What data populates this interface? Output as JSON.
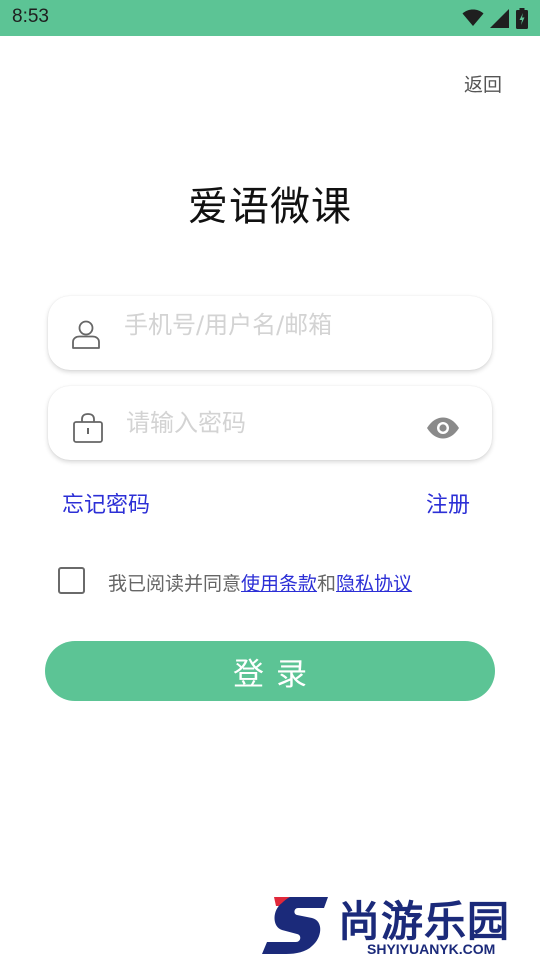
{
  "status_bar": {
    "time": "8:53",
    "background_color": "#5cc495",
    "icons": [
      "wifi-icon",
      "signal-icon",
      "battery-charging-icon"
    ]
  },
  "header": {
    "back_label": "返回"
  },
  "app": {
    "title": "爱语微课"
  },
  "form": {
    "username_placeholder": "手机号/用户名/邮箱",
    "username_value": "",
    "password_placeholder": "请输入密码",
    "password_value": "",
    "forgot_label": "忘记密码",
    "register_label": "注册",
    "agreement": {
      "checked": false,
      "prefix": "我已阅读并同意",
      "terms_label": "使用条款",
      "joiner": "和",
      "privacy_label": "隐私协议"
    },
    "login_label": "登录"
  },
  "watermark": {
    "brand": "尚游乐园",
    "url": "SHYIYUANYK.COM"
  },
  "colors": {
    "accent": "#5cc495",
    "link": "#2c2fd6"
  }
}
